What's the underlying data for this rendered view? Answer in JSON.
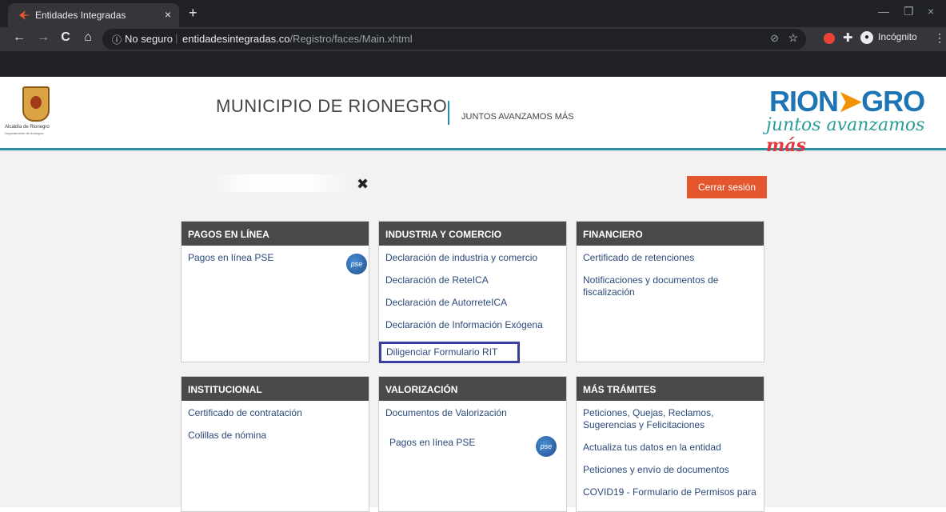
{
  "browser": {
    "tab_title": "Entidades Integradas",
    "tab_close": "×",
    "new_tab": "+",
    "nav_back": "←",
    "nav_forward": "→",
    "nav_reload": "C",
    "nav_home": "⌂",
    "security_icon": "ⓘ",
    "security_label": "No seguro",
    "url_host": "entidadesintegradas.co",
    "url_path": "/Registro/faces/Main.xhtml",
    "star": "☆",
    "incognito_label": "Incógnito",
    "menu": "⋮",
    "win_min": "—",
    "win_max": "❐",
    "win_close": "×"
  },
  "header": {
    "alcaldia_line1": "Alcaldía de Rionegro",
    "alcaldia_line2": "Departamento de Antioquia",
    "title": "MUNICIPIO DE RIONEGRO",
    "slogan": "JUNTOS AVANZAMOS MÁS",
    "brand_left": "RION",
    "brand_arrow": "➤",
    "brand_right": "GRO",
    "brand_tag": "juntos avanzamos ",
    "brand_tag_mas": "más"
  },
  "toolbar": {
    "tools_icon": "✖",
    "logout_label": "Cerrar sesión"
  },
  "cards": {
    "pagos": {
      "title": "PAGOS EN LÍNEA",
      "links": [
        "Pagos en línea PSE"
      ],
      "pse": "pse"
    },
    "industria": {
      "title": "INDUSTRIA Y COMERCIO",
      "links": [
        "Declaración de industria y comercio",
        "Declaración de ReteICA",
        "Declaración de AutorreteICA",
        "Declaración de Información Exógena",
        "Diligenciar Formulario RIT"
      ]
    },
    "financiero": {
      "title": "FINANCIERO",
      "links": [
        "Certificado de retenciones",
        "Notificaciones y documentos de fiscalización"
      ]
    },
    "institucional": {
      "title": "INSTITUCIONAL",
      "links": [
        "Certificado de contratación",
        "Colillas de nómina"
      ]
    },
    "valorizacion": {
      "title": "VALORIZACIÓN",
      "links": [
        "Documentos de Valorización",
        "Pagos en línea PSE"
      ],
      "pse": "pse"
    },
    "mas_tramites": {
      "title": "MÁS TRÁMITES",
      "links": [
        "Peticiones, Quejas, Reclamos, Sugerencias y Felicitaciones",
        "Actualiza tus datos en la entidad",
        "Peticiones y envío de documentos",
        "COVID19 - Formulario de Permisos para"
      ]
    }
  }
}
